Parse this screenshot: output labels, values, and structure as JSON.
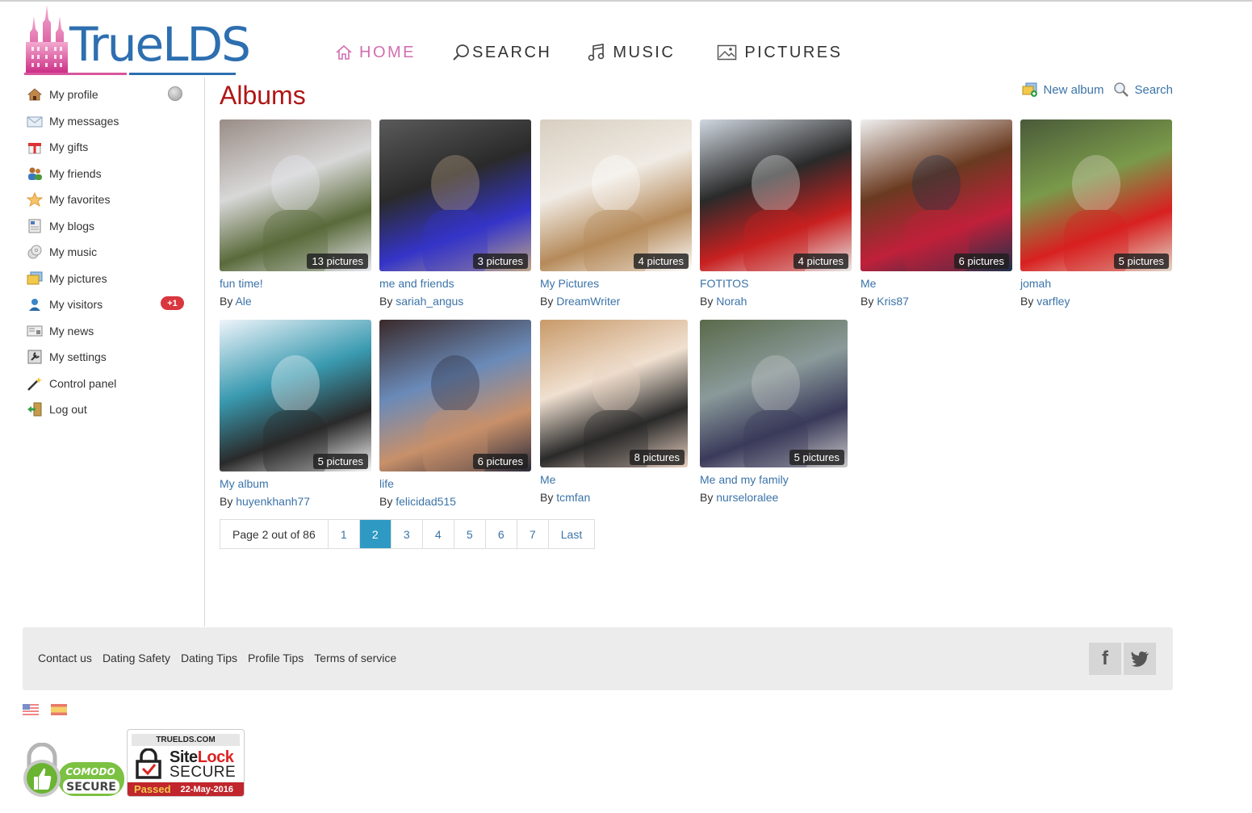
{
  "brand": {
    "name": "TrueLDS",
    "pink": "#d8559c",
    "blue": "#2d6fb0"
  },
  "topnav": [
    {
      "label": "HOME",
      "icon": "home-icon",
      "active": true
    },
    {
      "label": "SEARCH",
      "icon": "search-icon",
      "active": false
    },
    {
      "label": "MUSIC",
      "icon": "music-note-icon",
      "active": false
    },
    {
      "label": "PICTURES",
      "icon": "picture-icon",
      "active": false
    }
  ],
  "sidebar": {
    "items": [
      {
        "label": "My profile",
        "icon": "house-icon"
      },
      {
        "label": "My messages",
        "icon": "envelope-icon"
      },
      {
        "label": "My gifts",
        "icon": "gift-icon"
      },
      {
        "label": "My friends",
        "icon": "friends-icon"
      },
      {
        "label": "My favorites",
        "icon": "star-icon"
      },
      {
        "label": "My blogs",
        "icon": "blog-icon"
      },
      {
        "label": "My music",
        "icon": "cd-icon"
      },
      {
        "label": "My pictures",
        "icon": "pictures-icon"
      },
      {
        "label": "My visitors",
        "icon": "visitor-icon"
      },
      {
        "label": "My news",
        "icon": "news-icon"
      },
      {
        "label": "My settings",
        "icon": "wrench-icon"
      },
      {
        "label": "Control panel",
        "icon": "magic-wand-icon"
      },
      {
        "label": "Log out",
        "icon": "exit-door-icon"
      }
    ],
    "visitors_badge": "+1",
    "profile_status_icon": "globe-icon"
  },
  "main": {
    "title": "Albums",
    "actions": {
      "new_album": "New album",
      "search": "Search"
    },
    "by_prefix": "By",
    "albums": [
      {
        "title": "fun time!",
        "author": "Ale",
        "count": "13 pictures"
      },
      {
        "title": "me and friends",
        "author": "sariah_angus",
        "count": "3 pictures"
      },
      {
        "title": "My Pictures",
        "author": "DreamWriter",
        "count": "4 pictures"
      },
      {
        "title": "FOTITOS",
        "author": "Norah",
        "count": "4 pictures"
      },
      {
        "title": "Me",
        "author": "Kris87",
        "count": "6 pictures"
      },
      {
        "title": "jomah",
        "author": "varfley",
        "count": "5 pictures"
      },
      {
        "title": "My album",
        "author": "huyenkhanh77",
        "count": "5 pictures"
      },
      {
        "title": "life",
        "author": "felicidad515",
        "count": "6 pictures"
      },
      {
        "title": "Me",
        "author": "tcmfan",
        "count": "8 pictures"
      },
      {
        "title": "Me and my family",
        "author": "nurseloralee",
        "count": "5 pictures"
      }
    ],
    "pagination": {
      "summary": "Page 2 out of 86",
      "pages": [
        "1",
        "2",
        "3",
        "4",
        "5",
        "6",
        "7"
      ],
      "current": "2",
      "last": "Last",
      "active_color": "#2e9ac4"
    }
  },
  "footer": {
    "links": [
      "Contact us",
      "Dating Safety",
      "Dating Tips",
      "Profile Tips",
      "Terms of service"
    ],
    "social": [
      "facebook-icon",
      "twitter-icon"
    ],
    "languages": [
      "English",
      "Español"
    ]
  },
  "badges": {
    "comodo": {
      "line1": "COMODO",
      "line2": "SECURE"
    },
    "sitelock": {
      "domain": "TRUELDS.COM",
      "brand_a": "Site",
      "brand_b": "Lock",
      "secure": "SECURE",
      "passed": "Passed",
      "date": "22-May-2016"
    }
  }
}
